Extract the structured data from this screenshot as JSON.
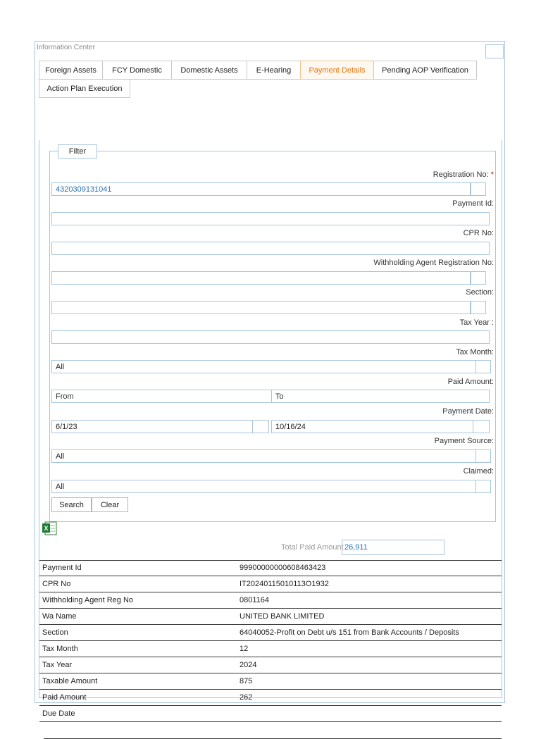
{
  "panel": {
    "title": "Information Center"
  },
  "tabs": [
    {
      "label": "Foreign Assets",
      "active": false
    },
    {
      "label": "FCY Domestic",
      "active": false
    },
    {
      "label": "Domestic Assets",
      "active": false
    },
    {
      "label": "E-Hearing",
      "active": false
    },
    {
      "label": "Payment Details",
      "active": true
    },
    {
      "label": "Pending AOP Verification",
      "active": false
    },
    {
      "label": "Action Plan Execution",
      "active": false
    }
  ],
  "filter": {
    "legend": "Filter",
    "registration_no": {
      "label": "Registration No:",
      "required_mark": "*",
      "value": "4320309131041"
    },
    "payment_id": {
      "label": "Payment Id:",
      "value": ""
    },
    "cpr_no": {
      "label": "CPR No:",
      "value": ""
    },
    "wa_reg_no": {
      "label": "Withholding Agent Registration No:",
      "value": ""
    },
    "section": {
      "label": "Section:",
      "value": ""
    },
    "tax_year": {
      "label": "Tax Year :",
      "value": ""
    },
    "tax_month": {
      "label": "Tax Month:",
      "value": "All"
    },
    "paid_amount": {
      "label": "Paid Amount:",
      "from_placeholder": "From",
      "to_placeholder": "To"
    },
    "payment_date": {
      "label": "Payment Date:",
      "from": "6/1/23",
      "to": "10/16/24"
    },
    "payment_source": {
      "label": "Payment Source:",
      "value": "All"
    },
    "claimed": {
      "label": "Claimed:",
      "value": "All"
    },
    "search_label": "Search",
    "clear_label": "Clear"
  },
  "total": {
    "label": "Total Paid Amount",
    "value": "26,911"
  },
  "details": [
    {
      "key": "Payment Id",
      "value": "99900000000608463423"
    },
    {
      "key": "CPR No",
      "value": "IT20240115010113O1932"
    },
    {
      "key": "Withholding Agent Reg No",
      "value": "0801164"
    },
    {
      "key": "Wa Name",
      "value": "UNITED BANK LIMITED"
    },
    {
      "key": "Section",
      "value": "64040052-Profit on Debt u/s 151 from Bank Accounts / Deposits"
    },
    {
      "key": "Tax Month",
      "value": "12"
    },
    {
      "key": "Tax Year",
      "value": "2024"
    },
    {
      "key": "Taxable Amount",
      "value": "875"
    },
    {
      "key": "Paid Amount",
      "value": "262"
    },
    {
      "key": "Due Date",
      "value": ""
    }
  ],
  "colors": {
    "border": "#a7c5de",
    "active_tab": "#e9740a",
    "value_blue": "#2a72b5"
  },
  "icons": {
    "export": "excel-icon"
  }
}
